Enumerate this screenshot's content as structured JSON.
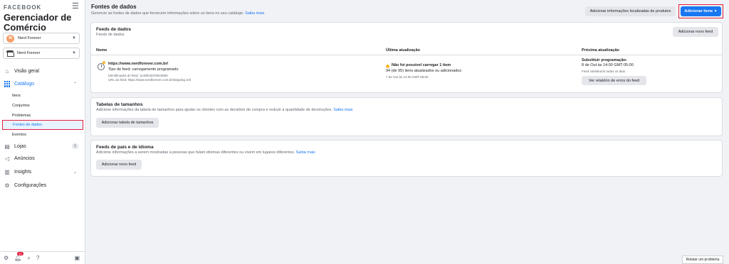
{
  "sidebar": {
    "brand": "FACEBOOK",
    "app_title": "Gerenciador de Comércio",
    "account": {
      "avatar_letter": "N",
      "name": "Nerd Forever"
    },
    "store": {
      "name": "Nerd Forever"
    },
    "nav": {
      "overview": "Visão geral",
      "catalog": "Catálogo",
      "catalog_items": [
        "Itens",
        "Conjuntos",
        "Problemas",
        "Fontes de dados",
        "Eventos"
      ],
      "shops": "Lojas",
      "shops_badge": "1",
      "ads": "Anúncios",
      "insights": "Insights",
      "settings": "Configurações"
    },
    "footer": {
      "notif_count": "10"
    }
  },
  "header": {
    "title": "Fontes de dados",
    "subtitle": "Gerencie as fontes de dados que fornecem informações sobre os itens no seu catálogo.",
    "learn_more": "Saiba mais",
    "btn_localized": "Adicionar informações localizadas de produtos",
    "btn_add_items": "Adicionar itens"
  },
  "feeds_card": {
    "title": "Feeds de dados",
    "subtitle": "Feeds de dados",
    "add_button": "Adicionar novo feed",
    "columns": [
      "Nome",
      "Última atualização",
      "Próxima atualização"
    ],
    "row": {
      "url": "https://www.nerdforever.com.br/",
      "feed_type": "Tipo de feed: carregamento programado",
      "feed_id": "Identificação do feed: 1148023379022690",
      "feed_url": "URL do feed: https://www.nerdforever.com.br/stepping.xml",
      "status_title": "Não foi possível carregar 1 item",
      "status_detail": "94 (de 95) itens atualizados ou adicionados",
      "status_date": "7 de Out às 14:00 GMT-05:00",
      "next_title": "Substituir programação:",
      "next_date": "8 de Out às 14:00 GMT-05:00",
      "next_note": "Feed substituído todos os dias",
      "error_report_button": "Ver relatório de erros do feed"
    }
  },
  "sizes_card": {
    "title": "Tabelas de tamanhos",
    "subtitle": "Adicione informações da tabela de tamanhos para ajudar os clientes com as decisões de compra e reduzir a quantidade de devoluções.",
    "learn_more": "Saiba mais",
    "add_button": "Adicionar tabela de tamanhos"
  },
  "locale_card": {
    "title": "Feeds de país e de idioma",
    "subtitle": "Adicione informações a serem mostradas a pessoas que falam idiomas diferentes ou vivem em lugares diferentes.",
    "learn_more": "Saiba mais",
    "add_button": "Adicionar novo feed"
  },
  "report_problem": "Relatar um problema"
}
